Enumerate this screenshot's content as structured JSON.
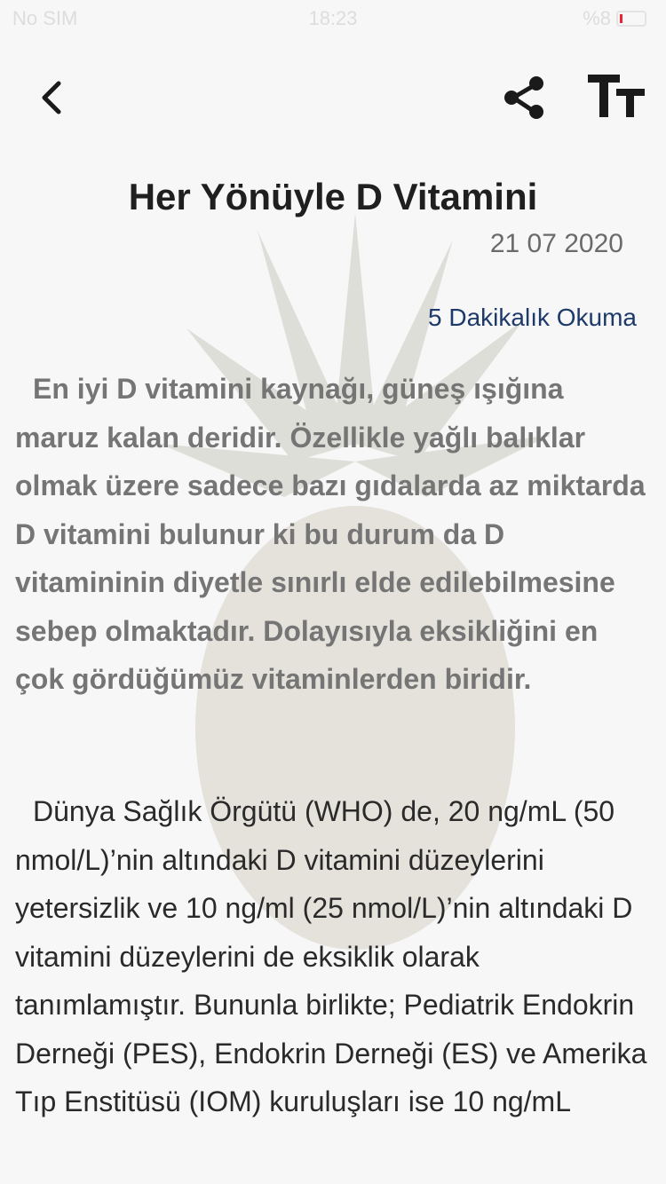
{
  "status_bar": {
    "carrier": "No SIM",
    "time": "18:23",
    "battery": "%8"
  },
  "toolbar": {
    "back_icon": "chevron-left-icon",
    "share_icon": "share-icon",
    "text_size_icon": "text-size-icon"
  },
  "article": {
    "title": "Her Yönüyle D Vitamini",
    "date": "21 07 2020",
    "reading_time": "5 Dakikalık Okuma",
    "paragraphs": [
      "En iyi D vitamini kaynağı, güneş ışığına maruz kalan deridir. Özellikle yağlı balıklar olmak üzere sadece bazı gıdalarda az miktarda D vitamini bulunur ki bu durum da D vitamininin diyetle sınırlı elde edilebilmesine sebep olmaktadır. Dolayısıyla eksikliğini en çok gördüğümüz vitaminlerden biridir.",
      "Dünya Sağlık Örgütü (WHO) de, 20 ng/mL (50 nmol/L)’nin altındaki D vitamini düzeylerini yetersizlik ve 10 ng/ml (25 nmol/L)’nin altındaki D vitamini düzeylerini de eksiklik olarak tanımlamıştır. Bununla birlikte; Pediatrik Endokrin Derneği (PES), Endokrin Derneği (ES) ve Amerika Tıp Enstitüsü (IOM) kuruluşları ise 10 ng/mL"
    ]
  },
  "colors": {
    "accent": "#1d3a6b",
    "emphasis_text": "#757575",
    "body_text": "#2a2a2a",
    "background": "#f7f7f7"
  }
}
